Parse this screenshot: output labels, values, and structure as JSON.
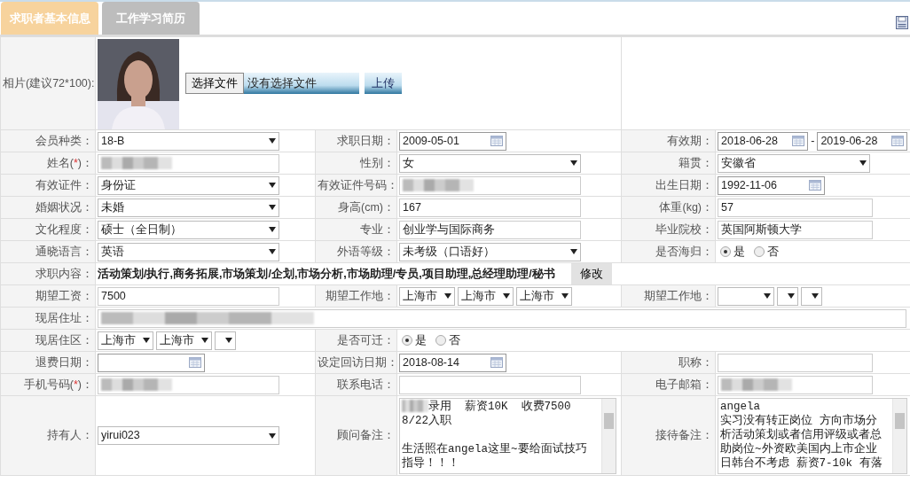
{
  "tabs": [
    {
      "label": "求职者基本信息",
      "selected": true
    },
    {
      "label": "工作学习简历",
      "selected": false
    }
  ],
  "photo": {
    "label": "相片(建议72*100):",
    "file_button": "选择文件",
    "file_status": "没有选择文件",
    "upload_button": "上传"
  },
  "rows": [
    [
      {
        "label": "会员种类：",
        "field": {
          "kind": "select",
          "value": "18-B"
        }
      },
      {
        "label": "求职日期：",
        "field": {
          "kind": "date",
          "value": "2009-05-01"
        }
      },
      {
        "label": "有效期：",
        "field": {
          "kind": "date_range",
          "from": "2018-06-28",
          "separator": "-",
          "to": "2019-06-28"
        }
      }
    ],
    [
      {
        "label": "姓名(",
        "required": "*",
        "label_end": ")：",
        "field": {
          "kind": "text",
          "redacted": true
        }
      },
      {
        "label": "性别：",
        "field": {
          "kind": "select",
          "value": "女"
        }
      },
      {
        "label": "籍贯：",
        "field": {
          "kind": "select",
          "value": "安徽省"
        }
      }
    ],
    [
      {
        "label": "有效证件：",
        "field": {
          "kind": "select",
          "value": "身份证"
        }
      },
      {
        "label": "有效证件号码：",
        "field": {
          "kind": "text",
          "redacted": true
        }
      },
      {
        "label": "出生日期：",
        "field": {
          "kind": "date",
          "value": "1992-11-06"
        }
      }
    ],
    [
      {
        "label": "婚姻状况：",
        "field": {
          "kind": "select",
          "value": "未婚"
        }
      },
      {
        "label": "身高(cm)：",
        "field": {
          "kind": "text",
          "value": "167"
        }
      },
      {
        "label": "体重(kg)：",
        "field": {
          "kind": "text",
          "value": "57"
        }
      }
    ],
    [
      {
        "label": "文化程度：",
        "field": {
          "kind": "select",
          "value": "硕士（全日制）"
        }
      },
      {
        "label": "专业：",
        "field": {
          "kind": "text",
          "value": "创业学与国际商务"
        }
      },
      {
        "label": "毕业院校：",
        "field": {
          "kind": "text",
          "value": "英国阿斯顿大学"
        }
      }
    ],
    [
      {
        "label": "通晓语言：",
        "field": {
          "kind": "select",
          "value": "英语"
        }
      },
      {
        "label": "外语等级：",
        "field": {
          "kind": "select",
          "value": "未考级（口语好）"
        }
      },
      {
        "label": "是否海归：",
        "field": {
          "kind": "radio",
          "options": [
            {
              "label": "是",
              "selected": true
            },
            {
              "label": "否",
              "selected": false
            }
          ]
        }
      }
    ],
    [
      {
        "label": "求职内容：",
        "field": {
          "kind": "text_button",
          "value": "活动策划/执行,商务拓展,市场策划/企划,市场分析,市场助理/专员,项目助理,总经理助理/秘书",
          "button": "修改"
        }
      }
    ],
    [
      {
        "label": "期望工资：",
        "field": {
          "kind": "text",
          "value": "7500"
        }
      },
      {
        "label": "期望工作地：",
        "field": {
          "kind": "selects",
          "values": [
            "上海市",
            "上海市",
            "上海市"
          ]
        }
      },
      {
        "label": "期望工作地：",
        "field": {
          "kind": "selects",
          "values": [
            {
              "blank": true
            },
            {
              "blank": true
            },
            {
              "blank": true
            }
          ]
        }
      }
    ],
    [
      {
        "label": "现居住址：",
        "field": {
          "kind": "text",
          "redacted": true
        }
      }
    ],
    [
      {
        "label": "现居住区：",
        "field": {
          "kind": "selects",
          "values": [
            "上海市",
            "上海市",
            {
              "blank": true
            }
          ]
        }
      },
      {
        "label": "是否可迁：",
        "field": {
          "kind": "radio",
          "options": [
            {
              "label": "是",
              "selected": true
            },
            {
              "label": "否",
              "selected": false
            }
          ]
        }
      }
    ],
    [
      {
        "label": "退费日期：",
        "field": {
          "kind": "date"
        }
      },
      {
        "label": "设定回访日期：",
        "field": {
          "kind": "date",
          "value": "2018-08-14"
        }
      },
      {
        "label": "职称：",
        "field": {
          "kind": "text"
        }
      }
    ],
    [
      {
        "label": "手机号码(",
        "required": "*",
        "label_end": ")：",
        "field": {
          "kind": "text",
          "redacted": true
        }
      },
      {
        "label": "联系电话：",
        "field": {
          "kind": "text"
        }
      },
      {
        "label": "电子邮箱：",
        "field": {
          "kind": "text",
          "redacted": true
        }
      }
    ],
    [
      {
        "label": "持有人：",
        "field": {
          "kind": "select",
          "value": "yirui023"
        }
      },
      {
        "label": "顾问备注：",
        "field": {
          "kind": "textarea",
          "redacted_start": true,
          "paragraphs": [
            [
              "录用  薪资10K  收费7500",
              "8/22入职"
            ],
            [
              "生活照在angela这里~要给面试技巧",
              "指导！！！"
            ]
          ]
        }
      },
      {
        "label": "接待备注：",
        "field": {
          "kind": "textarea",
          "paragraphs": [
            [
              "angela",
              "实习没有转正岗位 方向市场分",
              "析活动策划或者信用评级或者总",
              "助岗位~外资欧美国内上市企业",
              "日韩台不考虑 薪资7-10k 有落"
            ]
          ]
        }
      }
    ]
  ]
}
